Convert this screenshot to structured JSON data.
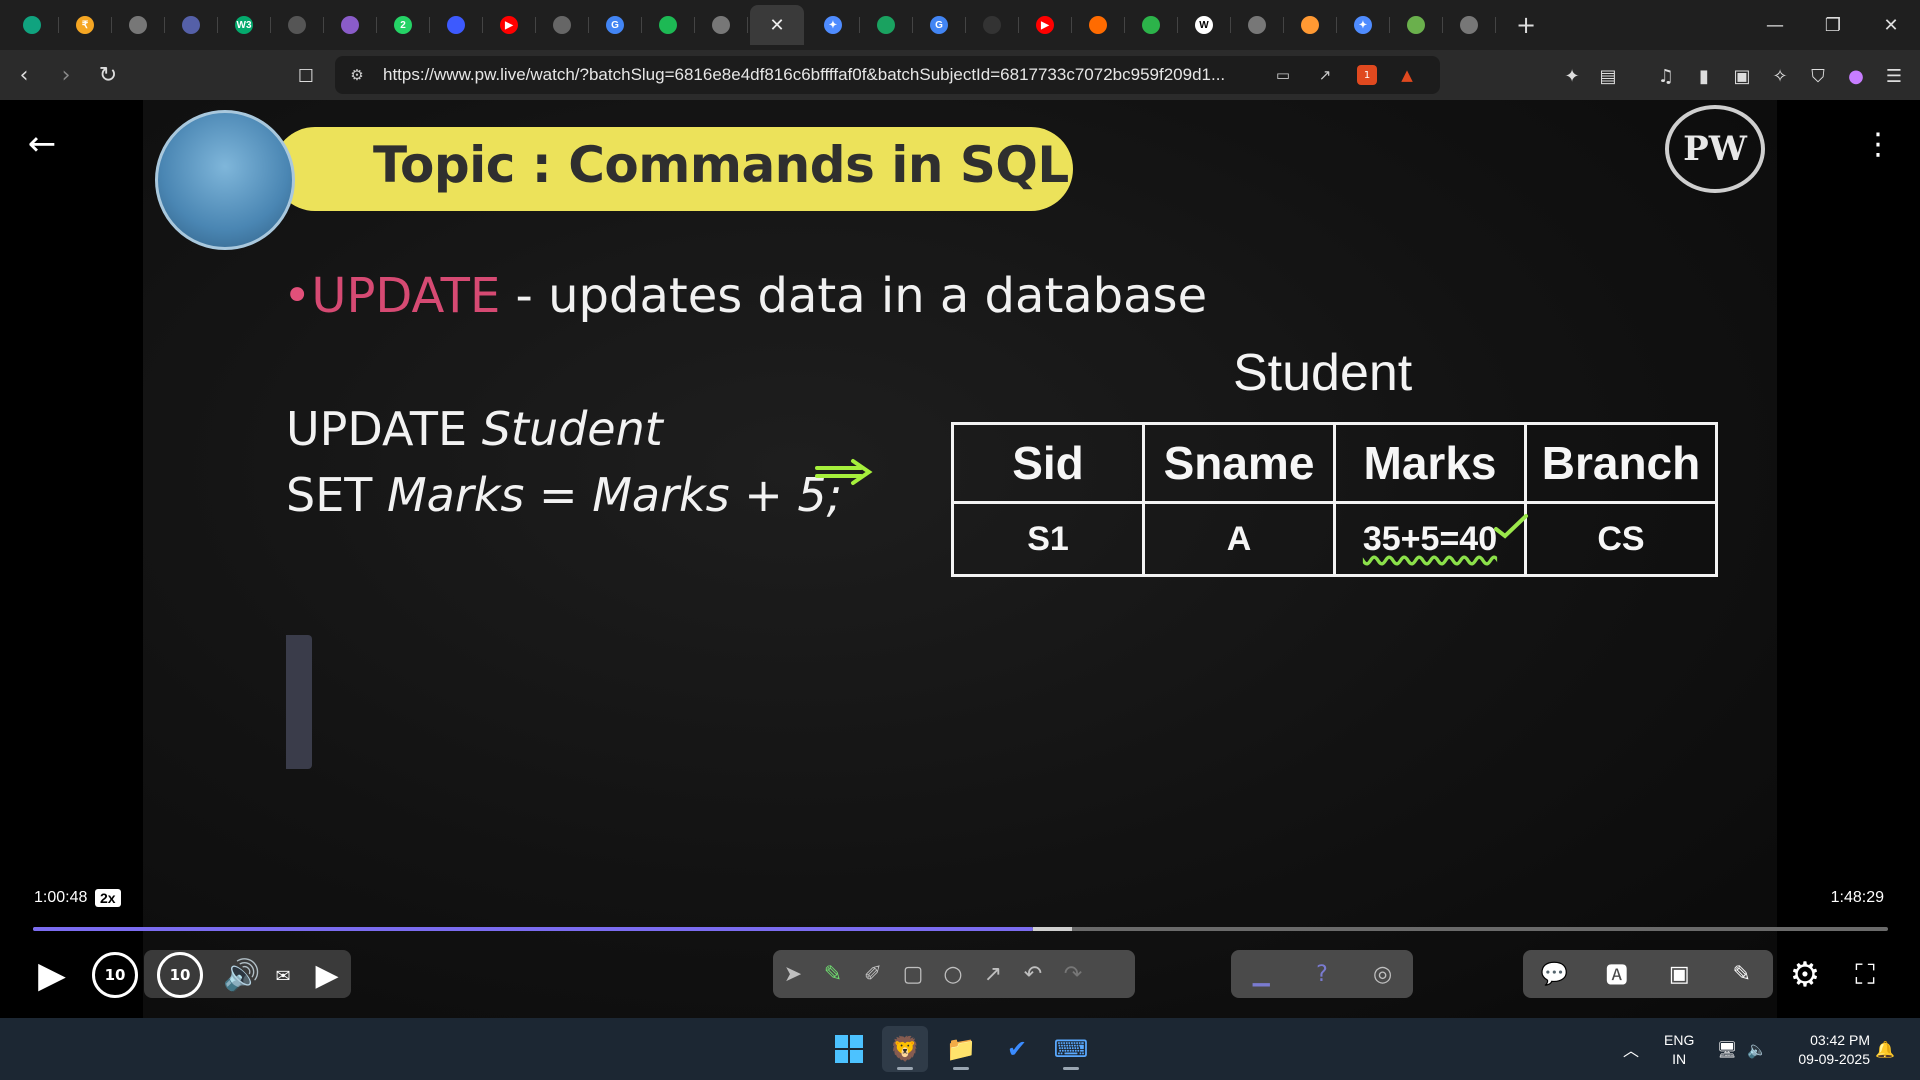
{
  "browser": {
    "tabs": [
      {
        "icon": "chatgpt-icon",
        "color": "#10a37f",
        "glyph": ""
      },
      {
        "icon": "coin-icon",
        "color": "#f5a623",
        "glyph": "₹"
      },
      {
        "icon": "globe-icon",
        "color": "#777777",
        "glyph": ""
      },
      {
        "icon": "app-icon",
        "color": "#5560a8",
        "glyph": ""
      },
      {
        "icon": "w3schools-icon",
        "color": "#04aa6d",
        "glyph": "W3"
      },
      {
        "icon": "app-icon",
        "color": "#555555",
        "glyph": ""
      },
      {
        "icon": "app-icon",
        "color": "#8a5cc9",
        "glyph": ""
      },
      {
        "icon": "whatsapp-icon",
        "color": "#25d366",
        "glyph": "2"
      },
      {
        "icon": "bookmark-icon",
        "color": "#3d5afe",
        "glyph": ""
      },
      {
        "icon": "youtube-icon",
        "color": "#ff0000",
        "glyph": "▶"
      },
      {
        "icon": "app-icon",
        "color": "#666666",
        "glyph": ""
      },
      {
        "icon": "google-icon",
        "color": "#4285f4",
        "glyph": "G"
      },
      {
        "icon": "spotify-icon",
        "color": "#1db954",
        "glyph": ""
      },
      {
        "icon": "globe-icon",
        "color": "#777777",
        "glyph": ""
      },
      {
        "icon": "close-icon",
        "color": "#3a3a3a",
        "glyph": "✕",
        "active": true
      },
      {
        "icon": "gemini-icon",
        "color": "#4f8cff",
        "glyph": "✦"
      },
      {
        "icon": "app-icon",
        "color": "#1aa260",
        "glyph": ""
      },
      {
        "icon": "google-icon",
        "color": "#4285f4",
        "glyph": "G"
      },
      {
        "icon": "screen-icon",
        "color": "#333333",
        "glyph": ""
      },
      {
        "icon": "youtube-icon",
        "color": "#ff0000",
        "glyph": "▶"
      },
      {
        "icon": "app-icon",
        "color": "#ff6b00",
        "glyph": ""
      },
      {
        "icon": "app-icon",
        "color": "#2cb34a",
        "glyph": ""
      },
      {
        "icon": "wikipedia-icon",
        "color": "#ffffff",
        "glyph": "W"
      },
      {
        "icon": "globe-icon",
        "color": "#777777",
        "glyph": ""
      },
      {
        "icon": "flag-icon",
        "color": "#ff9933",
        "glyph": ""
      },
      {
        "icon": "gemini-icon",
        "color": "#4f8cff",
        "glyph": "✦"
      },
      {
        "icon": "app-icon",
        "color": "#6ab04c",
        "glyph": ""
      },
      {
        "icon": "globe-icon",
        "color": "#777777",
        "glyph": ""
      }
    ],
    "new_tab": "+",
    "url": "https://www.pw.live/watch/?batchSlug=6816e8e4df816c6bffffaf0f&batchSubjectId=6817733c7072bc959f209d1...",
    "shields_badge": "1"
  },
  "slide": {
    "topic": "Topic : Commands in SQL",
    "bullet_dot": "•",
    "bullet_keyword": "UPDATE",
    "bullet_rest": " - updates data in a database",
    "sql_update": "UPDATE ",
    "sql_table": "Student",
    "sql_set": "SET ",
    "sql_col1": "Marks",
    "sql_eq": " = ",
    "sql_col2": "Marks",
    "sql_plus": " + 5;",
    "table_title": "Student",
    "columns": [
      "Sid",
      "Sname",
      "Marks",
      "Branch"
    ],
    "row": [
      "S1",
      "A",
      "35+5=40",
      "CS"
    ],
    "logo_text": "PW"
  },
  "player": {
    "current_time": "1:00:48",
    "speed": "2x",
    "total_time": "1:48:29",
    "progress": 0.539,
    "buffered": 0.56,
    "rewind_label": "10",
    "forward_label": "10"
  },
  "taskbar": {
    "lang_line1": "ENG",
    "lang_line2": "IN",
    "time": "03:42 PM",
    "date": "09-09-2025"
  }
}
